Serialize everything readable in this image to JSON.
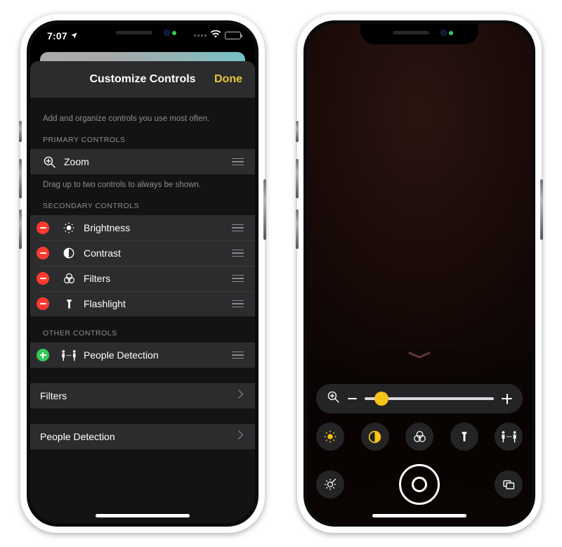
{
  "left_phone": {
    "status_bar": {
      "time": "7:07",
      "location_icon": "location-arrow-icon",
      "signal_icon": "cellular-dots-icon",
      "wifi_icon": "wifi-icon",
      "battery_icon": "battery-icon",
      "recording_indicator": "green-recording-dot"
    },
    "sheet": {
      "title": "Customize Controls",
      "done_label": "Done",
      "intro": "Add and organize controls you use most often.",
      "sections": [
        {
          "header": "PRIMARY CONTROLS",
          "footer": "Drag up to two controls to always be shown.",
          "rows": [
            {
              "label": "Zoom",
              "icon": "zoom-in-magnifier-icon",
              "badge": "none",
              "reorder": "reorder-handle-icon"
            }
          ]
        },
        {
          "header": "SECONDARY CONTROLS",
          "footer": "",
          "rows": [
            {
              "label": "Brightness",
              "icon": "brightness-sun-icon",
              "badge": "minus",
              "reorder": "reorder-handle-icon"
            },
            {
              "label": "Contrast",
              "icon": "contrast-half-circle-icon",
              "badge": "minus",
              "reorder": "reorder-handle-icon"
            },
            {
              "label": "Filters",
              "icon": "filters-venn-circles-icon",
              "badge": "minus",
              "reorder": "reorder-handle-icon"
            },
            {
              "label": "Flashlight",
              "icon": "flashlight-icon",
              "badge": "minus",
              "reorder": "reorder-handle-icon"
            }
          ]
        },
        {
          "header": "OTHER CONTROLS",
          "footer": "",
          "rows": [
            {
              "label": "People Detection",
              "icon": "people-detection-icon",
              "badge": "plus",
              "reorder": "reorder-handle-icon"
            }
          ]
        }
      ],
      "disclosure_rows": [
        {
          "label": "Filters",
          "chevron": "chevron-right-icon"
        },
        {
          "label": "People Detection",
          "chevron": "chevron-right-icon"
        }
      ]
    }
  },
  "right_phone": {
    "status_bar": {
      "recording_indicator": "green-recording-dot"
    },
    "camera": {
      "handle_icon": "chevron-down-handle-icon"
    },
    "zoom_slider": {
      "zoom_icon": "zoom-in-magnifier-icon",
      "decrease_icon": "minus-icon",
      "increase_icon": "plus-icon",
      "value_percent": 13
    },
    "tool_buttons": [
      {
        "icon": "brightness-sun-icon",
        "active": true
      },
      {
        "icon": "contrast-half-circle-icon",
        "active": true
      },
      {
        "icon": "filters-venn-circles-icon",
        "active": false
      },
      {
        "icon": "flashlight-icon",
        "active": false
      },
      {
        "icon": "people-detection-icon",
        "active": false
      }
    ],
    "action_buttons": {
      "settings_icon": "settings-gear-icon",
      "shutter_icon": "freeze-frame-shutter-button",
      "layers_icon": "multiple-frames-icon"
    }
  },
  "colors": {
    "accent_yellow": "#e8c53c",
    "slider_yellow": "#f5c518",
    "remove_red": "#ff3b30",
    "add_green": "#34c759",
    "sheet_bg": "#1c1c1e",
    "row_bg": "#2c2c2e"
  }
}
